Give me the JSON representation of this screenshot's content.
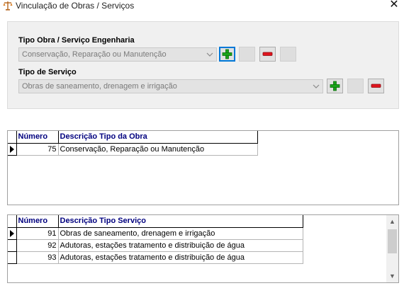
{
  "window": {
    "title": "Vinculação de Obras / Serviços",
    "close_glyph": "✕",
    "app_icon": "balance-scale-icon"
  },
  "form": {
    "obra_label": "Tipo Obra / Serviço Engenharia",
    "obra_value": "Conservação, Reparação ou Manutenção",
    "servico_label": "Tipo de Serviço",
    "servico_value": "Obras de saneamento, drenagem e irrigação"
  },
  "colors": {
    "add_green": "#1aa31a",
    "remove_red": "#e0141e",
    "header_text": "#00007f"
  },
  "obras_grid": {
    "columns": [
      "Número",
      "Descrição Tipo da Obra"
    ],
    "rows": [
      {
        "numero": "75",
        "descricao": "Conservação, Reparação ou Manutenção"
      }
    ]
  },
  "servicos_grid": {
    "columns": [
      "Número",
      "Descrição Tipo Serviço"
    ],
    "rows": [
      {
        "numero": "91",
        "descricao": "Obras de saneamento, drenagem e irrigação"
      },
      {
        "numero": "92",
        "descricao": "Adutoras, estações tratamento e distribuição de água"
      },
      {
        "numero": "93",
        "descricao": "Adutoras, estações tratamento e distribuição de água"
      }
    ]
  }
}
